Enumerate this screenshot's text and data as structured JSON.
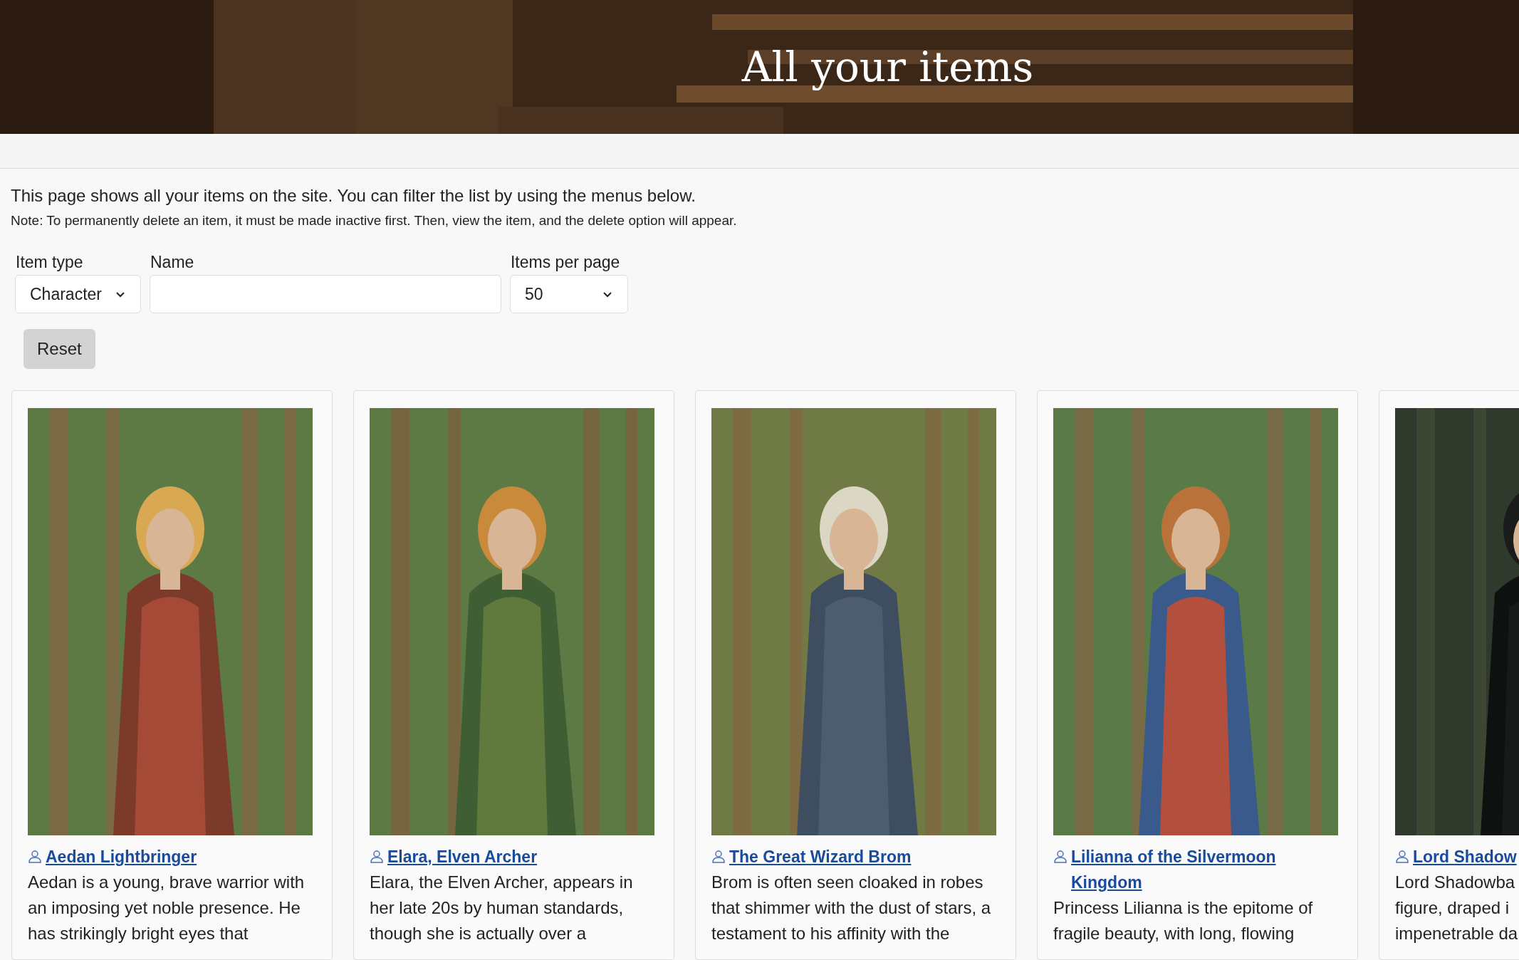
{
  "header": {
    "title": "All your items"
  },
  "intro": "This page shows all your items on the site. You can filter the list by using the menus below.",
  "note": "Note: To permanently delete an item, it must be made inactive first. Then, view the item, and the delete option will appear.",
  "filters": [
    {
      "kind": "select",
      "label": "Item type",
      "value": "Character"
    },
    {
      "kind": "text",
      "label": "Name"
    },
    {
      "kind": "select",
      "label": "Items per page",
      "value": "50"
    }
  ],
  "reset_button": "Reset",
  "items": [
    {
      "kind": "picture",
      "title": "Aedan Lightbringer",
      "description": "Aedan is a young, brave warrior with an imposing yet noble presence. He has strikingly bright eyes that"
    },
    {
      "kind": "picture",
      "title": "Elara, Elven Archer",
      "description": "Elara, the Elven Archer, appears in her late 20s by human standards, though she is actually over a"
    },
    {
      "kind": "picture",
      "title": "The Great Wizard Brom",
      "description": "Brom is often seen cloaked in robes that shimmer with the dust of stars, a testament to his affinity with the"
    },
    {
      "kind": "picture",
      "title": "Lilianna of the Silvermoon Kingdom",
      "description": "Princess Lilianna is the epitome of fragile beauty, with long, flowing"
    },
    {
      "kind": "picture",
      "title": "Lord Shadow",
      "description": "Lord Shadowba figure, draped i impenetrable da"
    }
  ]
}
